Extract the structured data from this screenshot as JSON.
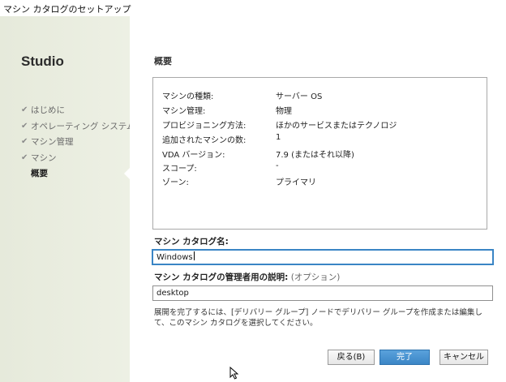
{
  "window": {
    "title": "マシン カタログのセットアップ"
  },
  "sidebar": {
    "brand": "Studio",
    "items": [
      {
        "label": "はじめに",
        "check": "✔"
      },
      {
        "label": "オペレーティング システム",
        "check": "✔"
      },
      {
        "label": "マシン管理",
        "check": "✔"
      },
      {
        "label": "マシン",
        "check": "✔"
      },
      {
        "label": "概要",
        "check": ""
      }
    ]
  },
  "main": {
    "heading": "概要",
    "summary": [
      {
        "label": "マシンの種類:",
        "value": "サーバー OS"
      },
      {
        "label": "マシン管理:",
        "value": "物理"
      },
      {
        "label": "プロビジョニング方法:",
        "value": "ほかのサービスまたはテクノロジ"
      },
      {
        "label": "追加されたマシンの数:",
        "value": "1"
      },
      {
        "label": "VDA バージョン:",
        "value": "7.9 (またはそれ以降)"
      },
      {
        "label": "スコープ:",
        "value": "-"
      },
      {
        "label": "ゾーン:",
        "value": "プライマリ"
      }
    ],
    "catalog_name_label": "マシン カタログ名:",
    "catalog_name_value": "Windows",
    "description_label": "マシン カタログの管理者用の説明:",
    "description_optional": "(オプション)",
    "description_value": "desktop",
    "note": "展開を完了するには、[デリバリー グループ] ノードでデリバリー グループを作成または編集して、このマシン カタログを選択してください。"
  },
  "buttons": {
    "back": "戻る(B)",
    "finish": "完了",
    "cancel": "キャンセル"
  }
}
